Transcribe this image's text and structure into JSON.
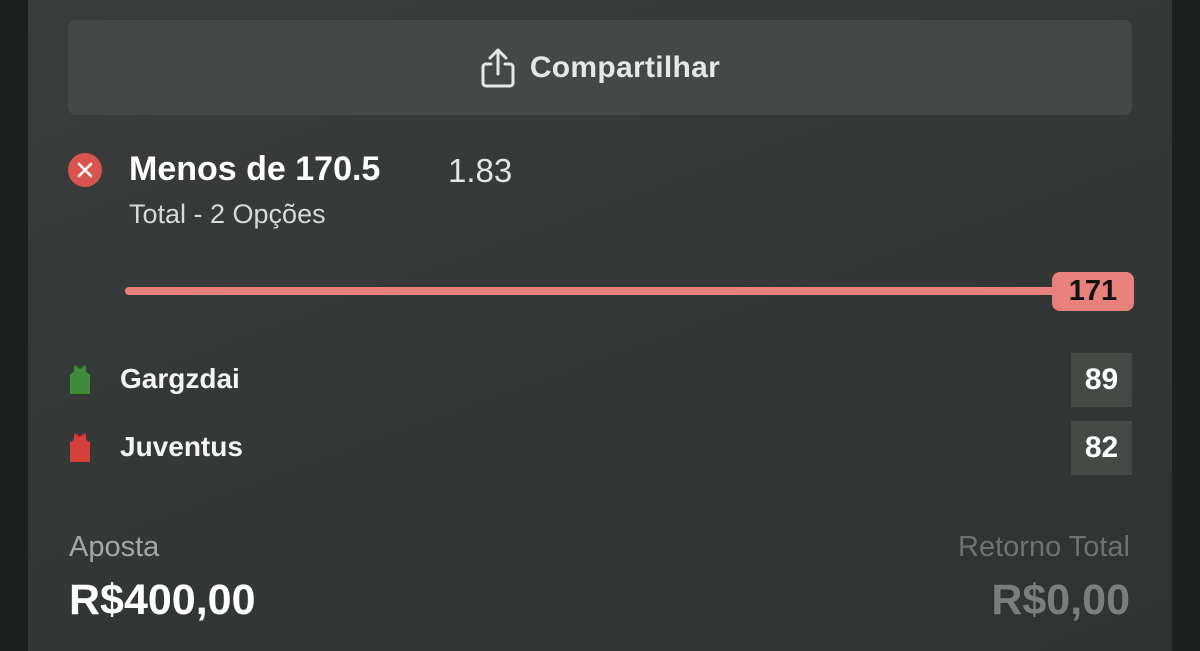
{
  "share": {
    "label": "Compartilhar",
    "icon": "share-icon"
  },
  "selection": {
    "status_icon": "close-icon",
    "status_color": "#d9534f",
    "title": "Menos de 170.5",
    "odds": "1.83",
    "market": "Total - 2 Opções"
  },
  "progress": {
    "current_total": "171",
    "fill_fraction": 1.0,
    "color": "#e8807c"
  },
  "teams": [
    {
      "name": "Gargzdai",
      "score": "89",
      "shirt_icon": "green-jersey-icon",
      "shirt_color": "#3f8b3a"
    },
    {
      "name": "Juventus",
      "score": "82",
      "shirt_icon": "red-jersey-icon",
      "shirt_color": "#d6403a"
    }
  ],
  "footer": {
    "stake_label": "Aposta",
    "stake_value": "R$400,00",
    "return_label": "Retorno Total",
    "return_value": "R$0,00"
  }
}
